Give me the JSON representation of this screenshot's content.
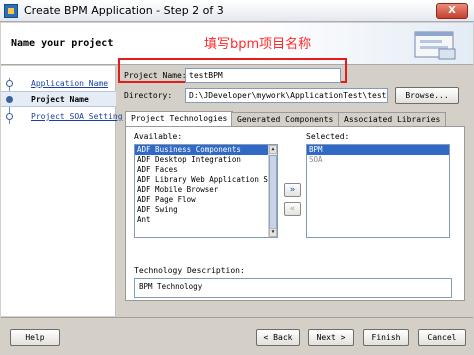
{
  "window": {
    "title": "Create BPM Application - Step 2 of 3",
    "close_label": "X"
  },
  "header": {
    "step_title": "Name your project",
    "annotation": "填写bpm项目名称"
  },
  "steps": [
    {
      "label": "Application Name",
      "state": "done"
    },
    {
      "label": "Project Name",
      "state": "current"
    },
    {
      "label": "Project SOA Setting",
      "state": "todo"
    }
  ],
  "form": {
    "project_name_label": "Project Name:",
    "project_name_value": "testBPM",
    "directory_label": "Directory:",
    "directory_value": "D:\\JDeveloper\\mywork\\ApplicationTest\\testBPM",
    "browse_label": "Browse..."
  },
  "tabs": [
    {
      "label": "Project Technologies",
      "active": true
    },
    {
      "label": "Generated Components",
      "active": false
    },
    {
      "label": "Associated Libraries",
      "active": false
    }
  ],
  "available": {
    "label": "Available:",
    "items": [
      "ADF Business Components",
      "ADF Desktop Integration",
      "ADF Faces",
      "ADF Library Web Application Su",
      "ADF Mobile Browser",
      "ADF Page Flow",
      "ADF Swing",
      "Ant"
    ],
    "selected_index": 0
  },
  "selected": {
    "label": "Selected:",
    "items": [
      "BPM",
      "SOA"
    ],
    "selected_index": 0
  },
  "movers": {
    "add_symbol": "»",
    "remove_symbol": "«"
  },
  "technology_description": {
    "label": "Technology Description:",
    "value": "BPM Technology"
  },
  "footer": {
    "help": "Help",
    "back": "< Back",
    "next": "Next >",
    "finish": "Finish",
    "cancel": "Cancel"
  },
  "colors": {
    "accent": "#3169c6",
    "annotation": "#ff2a2a",
    "highlight_box": "#e31c1c"
  }
}
